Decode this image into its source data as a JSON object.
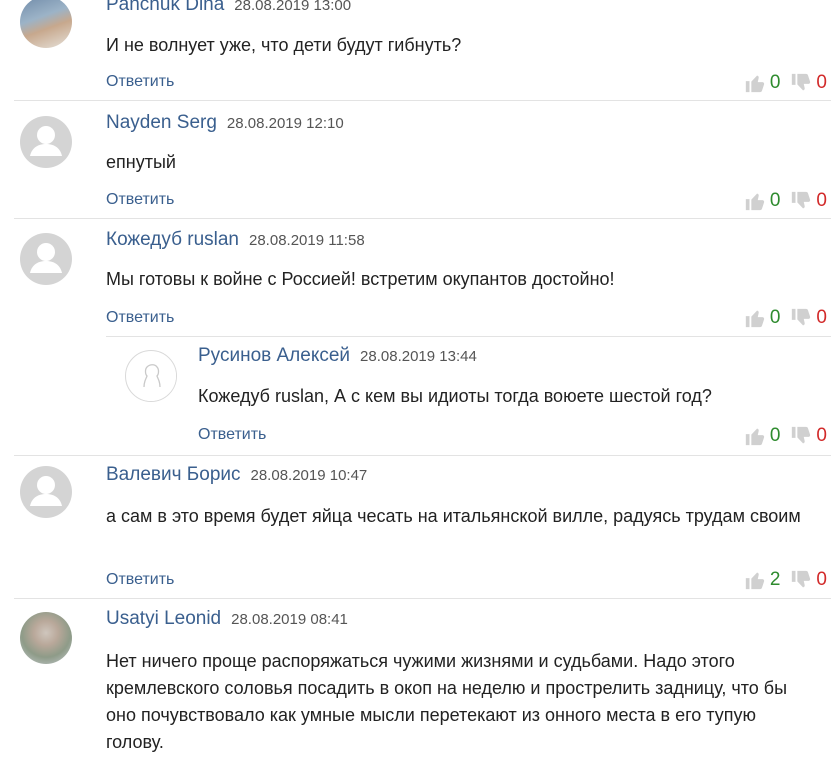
{
  "comments": [
    {
      "author": "Panchuk Dina",
      "date": "28.08.2019 13:00",
      "text": "И не волнует уже, что дети будут гибнуть?",
      "reply": "Ответить",
      "likes": "0",
      "dislikes": "0",
      "avatar": "photo"
    },
    {
      "author": "Nayden Serg",
      "date": "28.08.2019 12:10",
      "text": "епнутый",
      "reply": "Ответить",
      "likes": "0",
      "dislikes": "0",
      "avatar": "default"
    },
    {
      "author": "Кожедуб ruslan",
      "date": "28.08.2019 11:58",
      "text": "Мы готовы к войне с Россией! встретим окупантов достойно!",
      "reply": "Ответить",
      "likes": "0",
      "dislikes": "0",
      "avatar": "default"
    },
    {
      "author": "Русинов Алексей",
      "date": "28.08.2019 13:44",
      "text": "Кожедуб ruslan, А с кем вы идиоты тогда воюете шестой год?",
      "reply": "Ответить",
      "likes": "0",
      "dislikes": "0",
      "avatar": "outline"
    },
    {
      "author": "Валевич Борис",
      "date": "28.08.2019 10:47",
      "text": "а сам в это время будет яйца чесать на итальянской вилле, радуясь трудам своим",
      "reply": "Ответить",
      "likes": "2",
      "dislikes": "0",
      "avatar": "default"
    },
    {
      "author": "Usatyi Leonid",
      "date": "28.08.2019 08:41",
      "text": "Нет ничего проще распоряжаться чужими жизнями и судьбами. Надо этого кремлевского соловья посадить в окоп на неделю и прострелить задницу, что бы оно почувствовало как умные мысли перетекают из онного места в его тупую голову.",
      "avatar": "photo2"
    }
  ],
  "colors": {
    "author": "#3a5f8e",
    "like": "#2e8b2e",
    "dislike": "#d22a2a",
    "icon": "#d0d0d0"
  },
  "icons": {
    "like": "thumbs-up-icon",
    "dislike": "thumbs-down-icon",
    "default_avatar": "user-silhouette-icon"
  }
}
